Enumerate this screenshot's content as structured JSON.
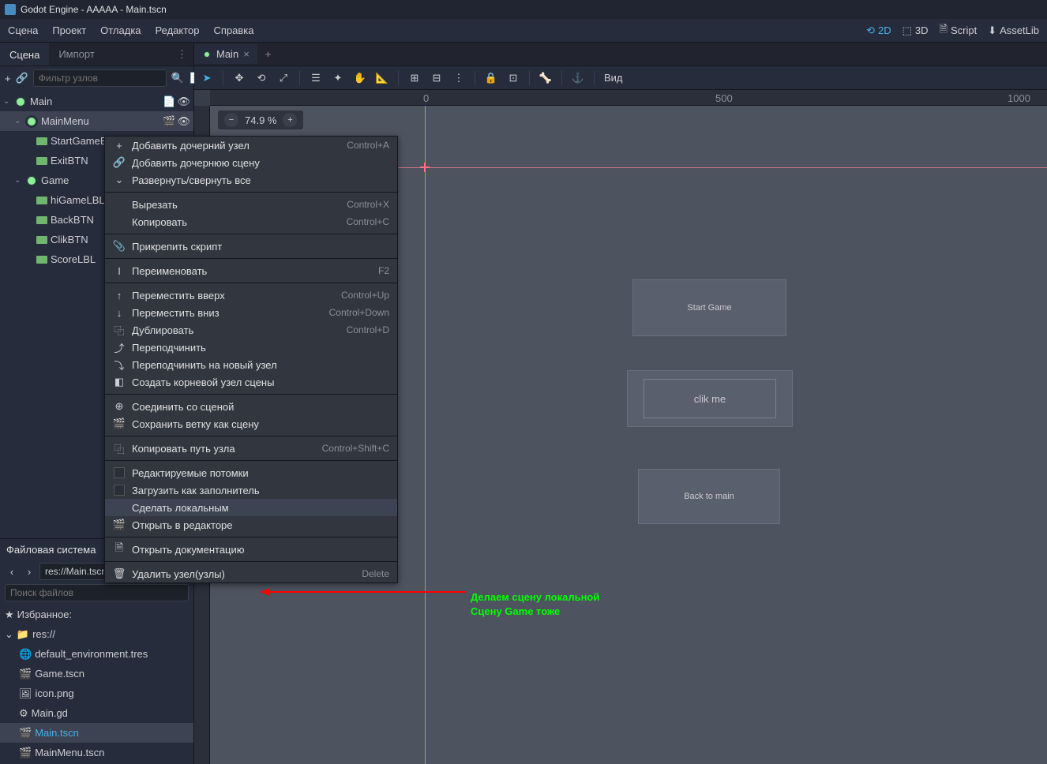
{
  "window": {
    "title": "Godot Engine - AAAAA - Main.tscn"
  },
  "menubar": {
    "items": [
      "Сцена",
      "Проект",
      "Отладка",
      "Редактор",
      "Справка"
    ],
    "right": {
      "d2": "2D",
      "d3": "3D",
      "script": "Script",
      "assetlib": "AssetLib"
    }
  },
  "scene_dock": {
    "tabs": [
      "Сцена",
      "Импорт"
    ],
    "filter_placeholder": "Фильтр узлов",
    "tree": {
      "root": "Main",
      "nodes": [
        {
          "name": "MainMenu",
          "children": [
            "StartGameBTN",
            "ExitBTN"
          ]
        },
        {
          "name": "Game",
          "children": [
            "hiGameLBL",
            "BackBTN",
            "ClikBTN",
            "ScoreLBL"
          ]
        }
      ]
    }
  },
  "filesystem": {
    "title": "Файловая система",
    "path": "res://Main.tscn",
    "search_placeholder": "Поиск файлов",
    "fav": "Избранное:",
    "root": "res://",
    "files": [
      "default_environment.tres",
      "Game.tscn",
      "icon.png",
      "Main.gd",
      "Main.tscn",
      "MainMenu.tscn"
    ]
  },
  "scene_tabs": {
    "main": "Main"
  },
  "viewport": {
    "zoom": "74.9 %",
    "view_label": "Вид",
    "ruler": {
      "r0": "0",
      "r500": "500",
      "r1000": "1000"
    },
    "buttons": {
      "start": "Start Game",
      "clik": "clik me",
      "back": "Back to main"
    }
  },
  "context_menu": {
    "items": [
      {
        "icon": "+",
        "label": "Добавить дочерний узел",
        "shortcut": "Control+A"
      },
      {
        "icon": "🔗",
        "label": "Добавить дочернюю сцену",
        "shortcut": ""
      },
      {
        "icon": "⌄",
        "label": "Развернуть/свернуть все",
        "shortcut": ""
      },
      {
        "sep": true
      },
      {
        "icon": "",
        "label": "Вырезать",
        "shortcut": "Control+X"
      },
      {
        "icon": "",
        "label": "Копировать",
        "shortcut": "Control+C"
      },
      {
        "sep": true
      },
      {
        "icon": "📎",
        "label": "Прикрепить скрипт",
        "shortcut": ""
      },
      {
        "sep": true
      },
      {
        "icon": "I",
        "label": "Переименовать",
        "shortcut": "F2"
      },
      {
        "sep": true
      },
      {
        "icon": "↑",
        "label": "Переместить вверх",
        "shortcut": "Control+Up"
      },
      {
        "icon": "↓",
        "label": "Переместить вниз",
        "shortcut": "Control+Down"
      },
      {
        "icon": "⿻",
        "label": "Дублировать",
        "shortcut": "Control+D"
      },
      {
        "icon": "⤴",
        "label": "Переподчинить",
        "shortcut": ""
      },
      {
        "icon": "⤵",
        "label": "Переподчинить на новый узел",
        "shortcut": ""
      },
      {
        "icon": "◧",
        "label": "Создать корневой узел сцены",
        "shortcut": ""
      },
      {
        "sep": true
      },
      {
        "icon": "⊕",
        "label": "Соединить со сценой",
        "shortcut": ""
      },
      {
        "icon": "🎬",
        "label": "Сохранить ветку как сцену",
        "shortcut": ""
      },
      {
        "sep": true
      },
      {
        "icon": "⿻",
        "label": "Копировать путь узла",
        "shortcut": "Control+Shift+C"
      },
      {
        "sep": true
      },
      {
        "check": true,
        "label": "Редактируемые потомки",
        "shortcut": ""
      },
      {
        "check": true,
        "label": "Загрузить как заполнитель",
        "shortcut": ""
      },
      {
        "icon": "",
        "label": "Сделать локальным",
        "shortcut": "",
        "hl": true
      },
      {
        "icon": "🎬",
        "label": "Открыть в редакторе",
        "shortcut": ""
      },
      {
        "sep": true
      },
      {
        "icon": "🗎",
        "label": "Открыть документацию",
        "shortcut": ""
      },
      {
        "sep": true
      },
      {
        "icon": "🗑",
        "label": "Удалить узел(узлы)",
        "shortcut": "Delete"
      }
    ]
  },
  "annotation": {
    "line1": "Делаем сцену локальной",
    "line2": "Сцену Game тоже"
  }
}
